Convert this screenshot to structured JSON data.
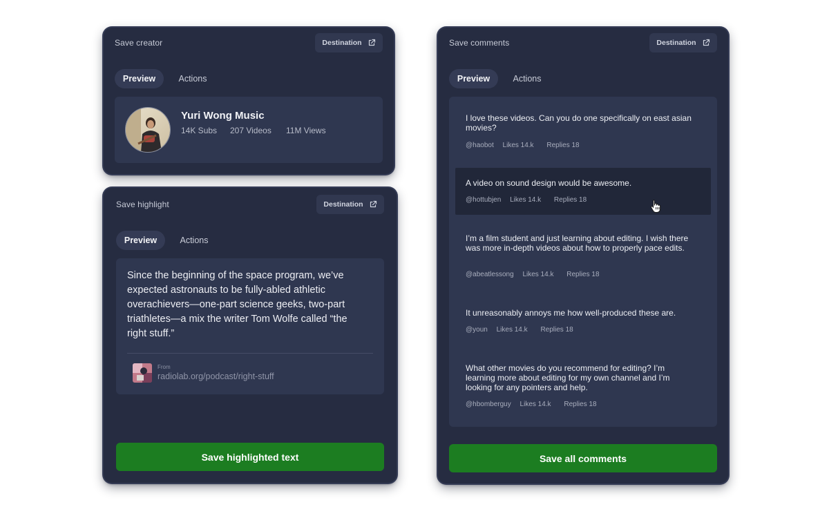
{
  "creator_card": {
    "title": "Save creator",
    "destination_label": "Destination",
    "tabs": [
      "Preview",
      "Actions"
    ],
    "name": "Yuri Wong Music",
    "subs": "14K Subs",
    "videos": "207 Videos",
    "views": "11M Views"
  },
  "highlight_card": {
    "title": "Save highlight",
    "destination_label": "Destination",
    "tabs": [
      "Preview",
      "Actions"
    ],
    "quote": "Since the beginning of the space program, we’ve expected astronauts to be fully-abled athletic overachievers—one-part science geeks, two-part triathletes—a mix the writer Tom Wolfe called “the right stuff.”",
    "from_label": "From",
    "source_url": "radiolab.org/podcast/right-stuff",
    "save_label": "Save highlighted text"
  },
  "comments_card": {
    "title": "Save comments",
    "destination_label": "Destination",
    "tabs": [
      "Preview",
      "Actions"
    ],
    "comments": [
      {
        "text": "I love these videos. Can you do one specifically on east asian movies?",
        "user": "@haobot",
        "likes": "Likes  14.k",
        "replies": "Replies  18"
      },
      {
        "text": "A video on sound design would be awesome.",
        "user": "@hottubjen",
        "likes": "Likes  14.k",
        "replies": "Replies  18"
      },
      {
        "text": "I’m a film student and just learning about editing. I wish there was more in-depth videos about how to properly pace edits.",
        "user": "@abeatlessong",
        "likes": "Likes  14.k",
        "replies": "Replies  18"
      },
      {
        "text": "It unreasonably annoys me how well-produced these are.",
        "user": "@youn",
        "likes": "Likes  14.k",
        "replies": "Replies  18"
      },
      {
        "text": "What other movies do you recommend for editing? I’m learning more about editing for my own channel and I’m looking for any pointers and help.",
        "user": "@hbomberguy",
        "likes": "Likes  14.k",
        "replies": "Replies  18"
      }
    ],
    "save_label": "Save all comments"
  },
  "colors": {
    "card_bg": "#262c41",
    "panel_bg": "#2f3750",
    "primary_button": "#1c7d21",
    "page_bg": "#ffffff"
  },
  "icons": [
    "external-link-icon",
    "pointer-hand-cursor-icon"
  ]
}
